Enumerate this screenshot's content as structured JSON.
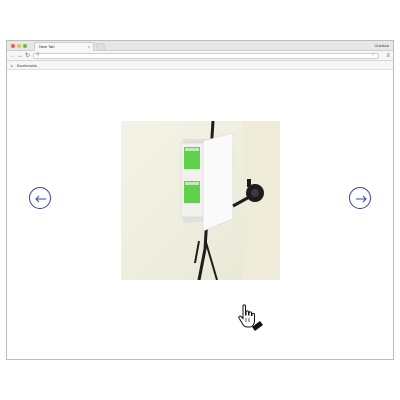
{
  "window": {
    "tab_title": "New Tab",
    "tab_close": "×",
    "profile_name": "Clarissa"
  },
  "toolbar": {
    "back_icon": "arrow-left-icon",
    "forward_icon": "arrow-right-icon",
    "reload_icon": "reload-icon",
    "address_value": "",
    "menu_icon": "hamburger-menu-icon"
  },
  "bookmarks_bar": {
    "label": "Bookmarks"
  },
  "gallery": {
    "image_subject": "photo of white stand with green labels and black clamp",
    "prev_icon": "arrow-left-icon",
    "next_icon": "arrow-right-icon"
  },
  "colors": {
    "accent": "#3344a8",
    "label_green": "#5fd04a"
  }
}
